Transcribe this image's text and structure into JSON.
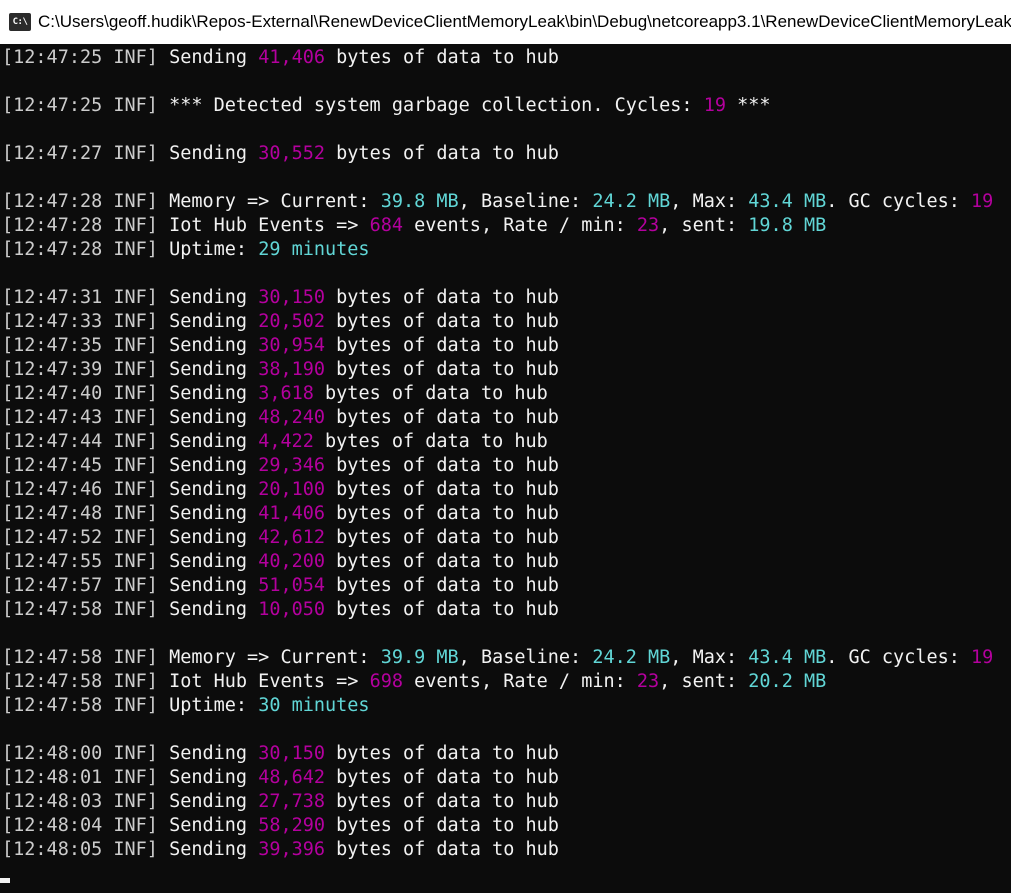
{
  "window": {
    "title": "C:\\Users\\geoff.hudik\\Repos-External\\RenewDeviceClientMemoryLeak\\bin\\Debug\\netcoreapp3.1\\RenewDeviceClientMemoryLeak.exe",
    "icon_label": "C:\\"
  },
  "colors": {
    "background": "#0c0c0c",
    "text": "#f2f2f2",
    "magenta_value": "#b4009e",
    "cyan_value": "#61d6d6"
  },
  "log": {
    "blocks": [
      [
        {
          "ts": "[12:47:25 INF]",
          "kind": "send",
          "bytes": "41,406"
        }
      ],
      [
        {
          "ts": "[12:47:25 INF]",
          "kind": "gc",
          "cycles": "19"
        }
      ],
      [
        {
          "ts": "[12:47:27 INF]",
          "kind": "send",
          "bytes": "30,552"
        }
      ],
      [
        {
          "ts": "[12:47:28 INF]",
          "kind": "memory",
          "current": "39.8 MB",
          "baseline": "24.2 MB",
          "max": "43.4 MB",
          "gc": "19"
        },
        {
          "ts": "[12:47:28 INF]",
          "kind": "hub",
          "events": "684",
          "rate": "23",
          "sent": "19.8 MB"
        },
        {
          "ts": "[12:47:28 INF]",
          "kind": "uptime",
          "uptime": "29 minutes"
        }
      ],
      [
        {
          "ts": "[12:47:31 INF]",
          "kind": "send",
          "bytes": "30,150"
        },
        {
          "ts": "[12:47:33 INF]",
          "kind": "send",
          "bytes": "20,502"
        },
        {
          "ts": "[12:47:35 INF]",
          "kind": "send",
          "bytes": "30,954"
        },
        {
          "ts": "[12:47:39 INF]",
          "kind": "send",
          "bytes": "38,190"
        },
        {
          "ts": "[12:47:40 INF]",
          "kind": "send",
          "bytes": "3,618"
        },
        {
          "ts": "[12:47:43 INF]",
          "kind": "send",
          "bytes": "48,240"
        },
        {
          "ts": "[12:47:44 INF]",
          "kind": "send",
          "bytes": "4,422"
        },
        {
          "ts": "[12:47:45 INF]",
          "kind": "send",
          "bytes": "29,346"
        },
        {
          "ts": "[12:47:46 INF]",
          "kind": "send",
          "bytes": "20,100"
        },
        {
          "ts": "[12:47:48 INF]",
          "kind": "send",
          "bytes": "41,406"
        },
        {
          "ts": "[12:47:52 INF]",
          "kind": "send",
          "bytes": "42,612"
        },
        {
          "ts": "[12:47:55 INF]",
          "kind": "send",
          "bytes": "40,200"
        },
        {
          "ts": "[12:47:57 INF]",
          "kind": "send",
          "bytes": "51,054"
        },
        {
          "ts": "[12:47:58 INF]",
          "kind": "send",
          "bytes": "10,050"
        }
      ],
      [
        {
          "ts": "[12:47:58 INF]",
          "kind": "memory",
          "current": "39.9 MB",
          "baseline": "24.2 MB",
          "max": "43.4 MB",
          "gc": "19"
        },
        {
          "ts": "[12:47:58 INF]",
          "kind": "hub",
          "events": "698",
          "rate": "23",
          "sent": "20.2 MB"
        },
        {
          "ts": "[12:47:58 INF]",
          "kind": "uptime",
          "uptime": "30 minutes"
        }
      ],
      [
        {
          "ts": "[12:48:00 INF]",
          "kind": "send",
          "bytes": "30,150"
        },
        {
          "ts": "[12:48:01 INF]",
          "kind": "send",
          "bytes": "48,642"
        },
        {
          "ts": "[12:48:03 INF]",
          "kind": "send",
          "bytes": "27,738"
        },
        {
          "ts": "[12:48:04 INF]",
          "kind": "send",
          "bytes": "58,290"
        },
        {
          "ts": "[12:48:05 INF]",
          "kind": "send",
          "bytes": "39,396"
        }
      ]
    ],
    "text": {
      "sending": " Sending ",
      "bytes_suffix": " bytes of data to hub",
      "gc_prefix": " *** Detected system garbage collection. Cycles: ",
      "gc_suffix": " ***",
      "mem_current": " Memory => Current: ",
      "mem_baseline": ", Baseline: ",
      "mem_max": ", Max: ",
      "mem_gc": ". GC cycles: ",
      "hub_prefix": " Iot Hub Events => ",
      "hub_events": " events, Rate / min: ",
      "hub_sent": ", sent: ",
      "uptime_prefix": " Uptime: "
    }
  }
}
